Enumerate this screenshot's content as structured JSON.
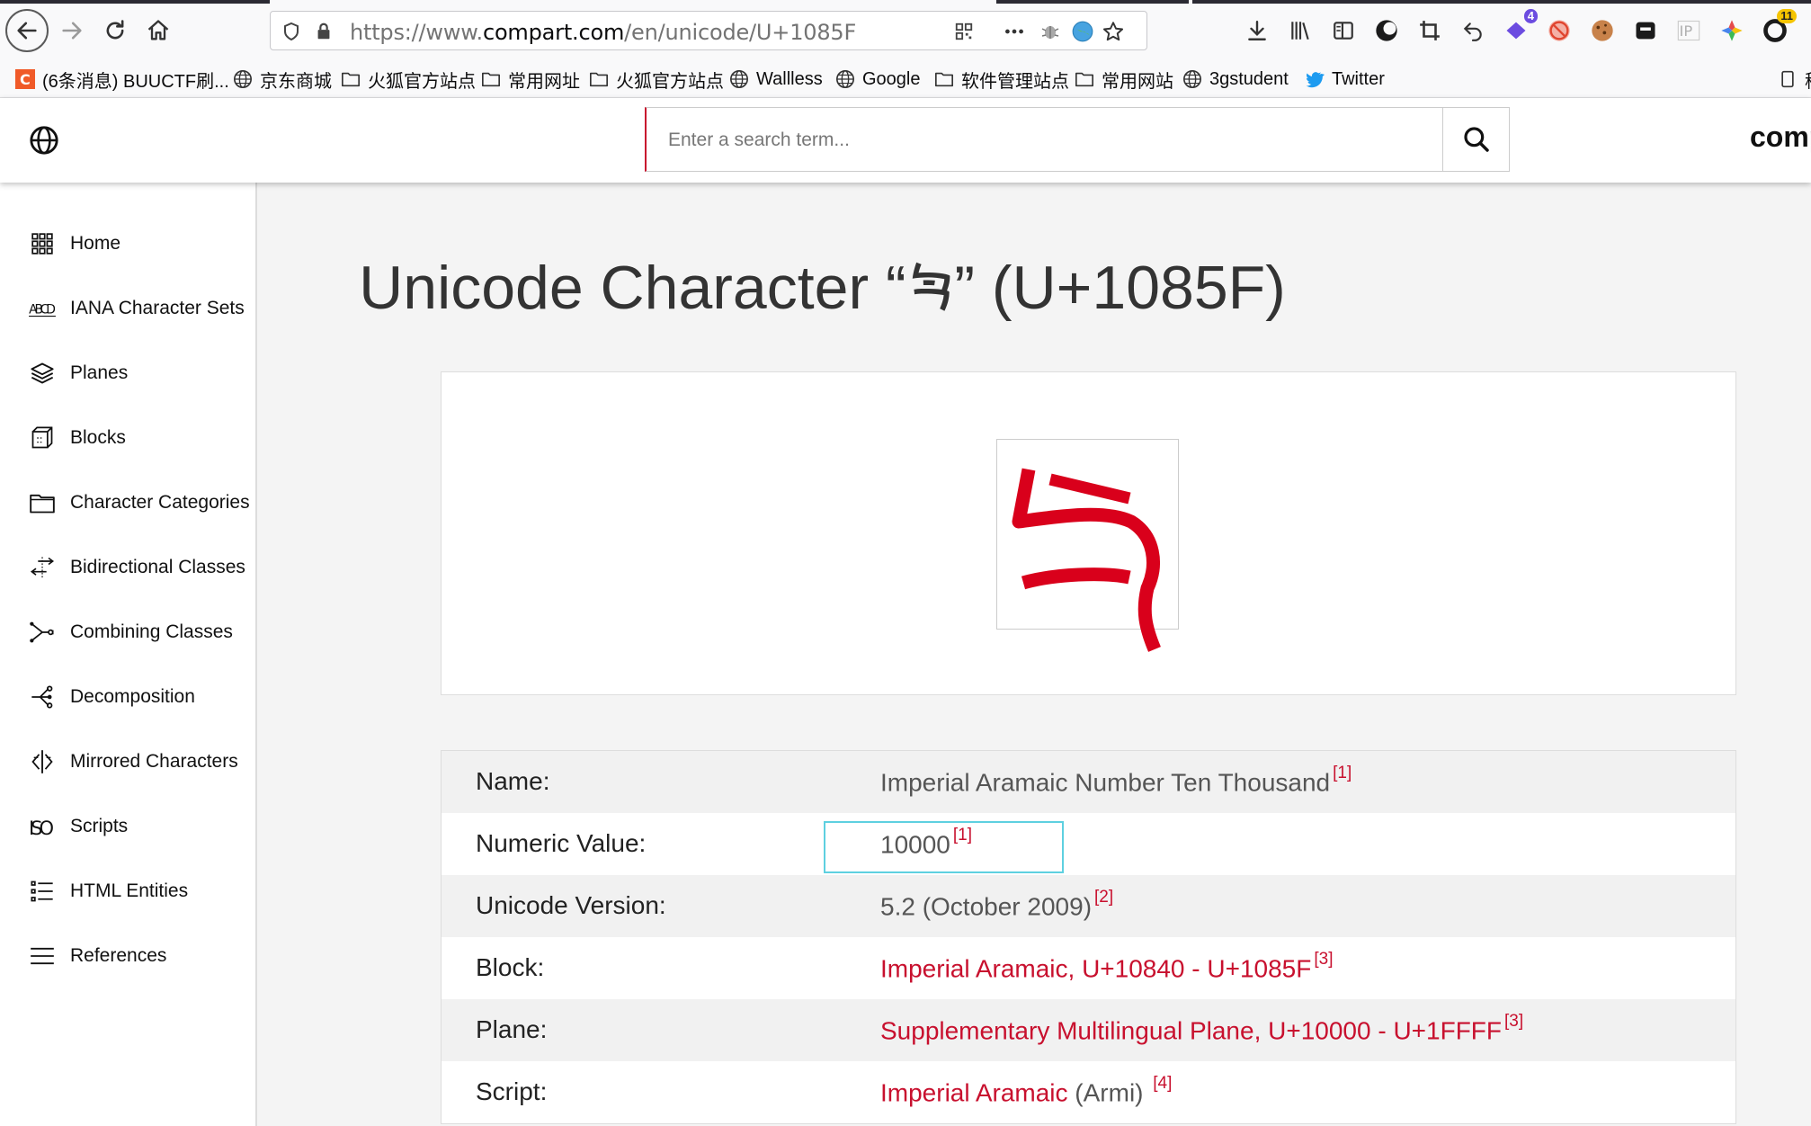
{
  "browser": {
    "url_prefix": "https://www.",
    "url_domain": "compart.com",
    "url_path": "/en/unicode/U+1085F",
    "extension_badges": {
      "dark": "4",
      "yellow": "11"
    }
  },
  "bookmarks": [
    "(6条消息) BUUCTF刷...",
    "京东商城",
    "火狐官方站点",
    "常用网址",
    "火狐官方站点",
    "Wallless",
    "Google",
    "软件管理站点",
    "常用网站",
    "3gstudent",
    "Twitter"
  ],
  "bookmarks_overflow": "移",
  "site": {
    "search_placeholder": "Enter a search term...",
    "brand": "comp"
  },
  "sidebar": {
    "items": [
      {
        "label": "Home",
        "icon": "grid-icon"
      },
      {
        "label": "IANA Character Sets",
        "icon": "abcd-icon"
      },
      {
        "label": "Planes",
        "icon": "layers-icon"
      },
      {
        "label": "Blocks",
        "icon": "cube-icon"
      },
      {
        "label": "Character Categories",
        "icon": "folder-icon"
      },
      {
        "label": "Bidirectional Classes",
        "icon": "bidi-icon"
      },
      {
        "label": "Combining Classes",
        "icon": "combining-icon"
      },
      {
        "label": "Decomposition",
        "icon": "decomposition-icon"
      },
      {
        "label": "Mirrored Characters",
        "icon": "mirror-icon"
      },
      {
        "label": "Scripts",
        "icon": "iso-icon"
      },
      {
        "label": "HTML Entities",
        "icon": "list-icon"
      },
      {
        "label": "References",
        "icon": "menu-icon"
      }
    ]
  },
  "page": {
    "title_prefix": "Unicode Character “",
    "title_char": "𐡟",
    "title_suffix": "” (U+1085F)",
    "glyph_color": "#d9001b"
  },
  "properties": [
    {
      "label": "Name:",
      "value": "Imperial Aramaic Number Ten Thousand",
      "value_link": false,
      "value_extra": "",
      "ref": "[1]"
    },
    {
      "label": "Numeric Value:",
      "value": "10000",
      "value_link": false,
      "value_extra": "",
      "ref": "[1]"
    },
    {
      "label": "Unicode Version:",
      "value": "5.2 (October 2009)",
      "value_link": false,
      "value_extra": "",
      "ref": "[2]"
    },
    {
      "label": "Block:",
      "value": "Imperial Aramaic, U+10840 - U+1085F",
      "value_link": true,
      "value_extra": "",
      "ref": "[3]"
    },
    {
      "label": "Plane:",
      "value": "Supplementary Multilingual Plane, U+10000 - U+1FFFF",
      "value_link": true,
      "value_extra": "",
      "ref": "[3]"
    },
    {
      "label": "Script:",
      "value": "Imperial Aramaic",
      "value_link": true,
      "value_extra": " (Armi) ",
      "ref": "[4]"
    }
  ]
}
